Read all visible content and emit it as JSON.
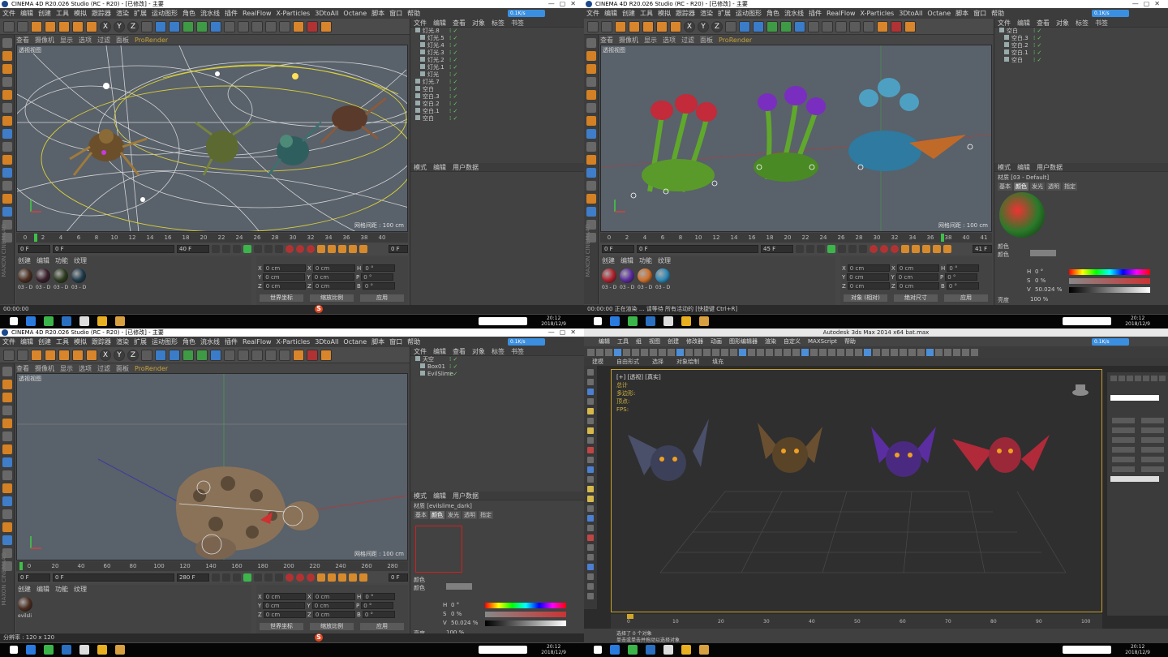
{
  "colors": {
    "c4d_bg": "#464646",
    "viewport": "#59616a",
    "accent_orange": "#d8852c",
    "playhead": "#3fbf4a",
    "max_bg": "#2b2b2b",
    "max_frame": "#c8a02c",
    "net_badge": "#3a8fe0"
  },
  "c4d_menu": [
    "文件",
    "编辑",
    "创建",
    "工具",
    "模拟",
    "跟踪器",
    "渲染",
    "扩展",
    "运动图形",
    "角色",
    "流水线",
    "插件",
    "RealFlow",
    "X-Particles",
    "3DtoAll",
    "Octane",
    "脚本",
    "窗口",
    "帮助"
  ],
  "net_badge": "0.1K/s",
  "q1": {
    "title": "CINEMA 4D R20.026 Studio (RC - R20) - [已修改] - 主要",
    "vp_menu": [
      "查看",
      "摄像机",
      "显示",
      "选项",
      "过滤",
      "面板"
    ],
    "prorender": "ProRender",
    "vp_name": "透视视图",
    "grid": "网格间距 : 100 cm",
    "ticks": [
      "0",
      "2",
      "4",
      "6",
      "8",
      "10",
      "12",
      "14",
      "16",
      "18",
      "20",
      "22",
      "24",
      "26",
      "28",
      "30",
      "32",
      "34",
      "36",
      "38",
      "40"
    ],
    "f_start": "0 F",
    "f_cur": "0 F",
    "f_end": "40 F",
    "f_end2": "40 F",
    "f_right": "0 F",
    "mat_menu": [
      "创建",
      "编辑",
      "功能",
      "纹理"
    ],
    "mat_labels": [
      "03 - D",
      "03 - D",
      "03 - D",
      "03 - D"
    ],
    "objects": [
      "灯光.8",
      "灯光.5",
      "灯光.4",
      "灯光.3",
      "灯光.2",
      "灯光.1",
      "灯光",
      "灯光.7",
      "空白",
      "空白.3",
      "空白.2",
      "空白.1",
      "空白"
    ],
    "om_menu": [
      "文件",
      "编辑",
      "查看",
      "对象",
      "标签",
      "书签"
    ],
    "ae_menu": [
      "模式",
      "编辑",
      "用户数据"
    ],
    "coords": {
      "x": "0 cm",
      "y": "0 cm",
      "z": "0 cm",
      "h": "0 °",
      "p": "0 °",
      "b": "0 °",
      "btn1": "世界坐标",
      "btn2": "缩放比例",
      "apply": "应用"
    },
    "status": "00:00:00"
  },
  "q2": {
    "title": "CINEMA 4D R20.026 Studio (RC - R20) - [已修改] - 主要",
    "vp_menu": [
      "查看",
      "摄像机",
      "显示",
      "选项",
      "过滤",
      "面板"
    ],
    "prorender": "ProRender",
    "vp_name": "透视视图",
    "grid": "网格间距 : 100 cm",
    "ticks": [
      "0",
      "2",
      "4",
      "6",
      "8",
      "10",
      "12",
      "14",
      "16",
      "18",
      "20",
      "22",
      "24",
      "26",
      "28",
      "30",
      "32",
      "34",
      "36",
      "38",
      "40",
      "41"
    ],
    "f_start": "0 F",
    "f_cur": "0 F",
    "f_end": "45 F",
    "f_end2": "45 F",
    "f_right": "41 F",
    "mat_menu": [
      "创建",
      "编辑",
      "功能",
      "纹理"
    ],
    "mat_labels": [
      "03 - D",
      "03 - D",
      "03 - D",
      "03 - D"
    ],
    "objects": [
      "空白",
      "空白.3",
      "空白.2",
      "空白.1",
      "空白"
    ],
    "om_menu": [
      "文件",
      "编辑",
      "查看",
      "对象",
      "标签",
      "书签"
    ],
    "ae_menu": [
      "模式",
      "编辑",
      "用户数据"
    ],
    "material_name": "材质 [03 - Default]",
    "mat_tabs": [
      "基本",
      "颜色",
      "发光",
      "透明",
      "指定"
    ],
    "color_lbl": "颜色",
    "color_sub": "颜色",
    "h": "0 °",
    "s": "0 %",
    "v": "50.024 %",
    "brightness_lbl": "亮度",
    "brightness": "100 %",
    "coords": {
      "x": "0 cm",
      "y": "0 cm",
      "z": "0 cm",
      "h": "0 °",
      "p": "0 °",
      "b": "0 °",
      "btn1": "对象 (相对)",
      "btn2": "绝对尺寸",
      "apply": "应用"
    },
    "status": "00:00:00 正在渲染 ... 请等待 所有活动的 [快捷键 Ctrl+R]"
  },
  "q3": {
    "title": "CINEMA 4D R20.026 Studio (RC - R20) - [已修改] - 主要",
    "vp_menu": [
      "查看",
      "摄像机",
      "显示",
      "选项",
      "过滤",
      "面板"
    ],
    "prorender": "ProRender",
    "vp_name": "透视视图",
    "grid": "网格间距 : 100 cm",
    "ticks": [
      "0",
      "20",
      "40",
      "60",
      "80",
      "100",
      "120",
      "140",
      "160",
      "180",
      "200",
      "220",
      "240",
      "260",
      "280"
    ],
    "f_start": "0 F",
    "f_cur": "0 F",
    "f_end": "280 F",
    "f_end2": "280 F",
    "f_right": "0 F",
    "mat_menu": [
      "创建",
      "编辑",
      "功能",
      "纹理"
    ],
    "mat_labels": [
      "evilsli"
    ],
    "objects": [
      "天空",
      "Box01",
      "EvilSlime"
    ],
    "om_menu": [
      "文件",
      "编辑",
      "查看",
      "对象",
      "标签",
      "书签"
    ],
    "ae_menu": [
      "模式",
      "编辑",
      "用户数据"
    ],
    "material_name": "材质 [evilslime_dark]",
    "mat_tabs": [
      "基本",
      "颜色",
      "发光",
      "透明",
      "指定"
    ],
    "color_lbl": "颜色",
    "color_sub": "颜色",
    "h": "0 °",
    "s": "0 %",
    "v": "50.024 %",
    "brightness_lbl": "亮度",
    "brightness": "100 %",
    "coords": {
      "x": "0 cm",
      "y": "0 cm",
      "z": "0 cm",
      "h": "0 °",
      "p": "0 °",
      "b": "0 °",
      "btn1": "世界坐标",
      "btn2": "缩放比例",
      "apply": "应用"
    },
    "status": "分辨率 : 120 x 120"
  },
  "q4": {
    "title": "Autodesk 3ds Max 2014 x64    bat.max",
    "menu": [
      "编辑",
      "工具",
      "组",
      "视图",
      "创建",
      "修改器",
      "动画",
      "图形编辑器",
      "渲染",
      "自定义",
      "MAXScript",
      "帮助"
    ],
    "ribbon": [
      "建模",
      "自由形式",
      "选择",
      "对象绘制",
      "填充"
    ],
    "vp_label": "[+] [透视] [真实]",
    "stats": [
      "总计",
      "多边形:",
      "顶点:",
      "FPS:"
    ],
    "track_ticks": [
      "0",
      "10",
      "20",
      "30",
      "40",
      "50",
      "60",
      "70",
      "80",
      "90",
      "100"
    ],
    "status1": "选择了 0 个对象",
    "status2": "单击或单击并拖动以选择对象"
  },
  "taskbar": {
    "clock_time": "20:12",
    "clock_date": "2018/12/9"
  }
}
